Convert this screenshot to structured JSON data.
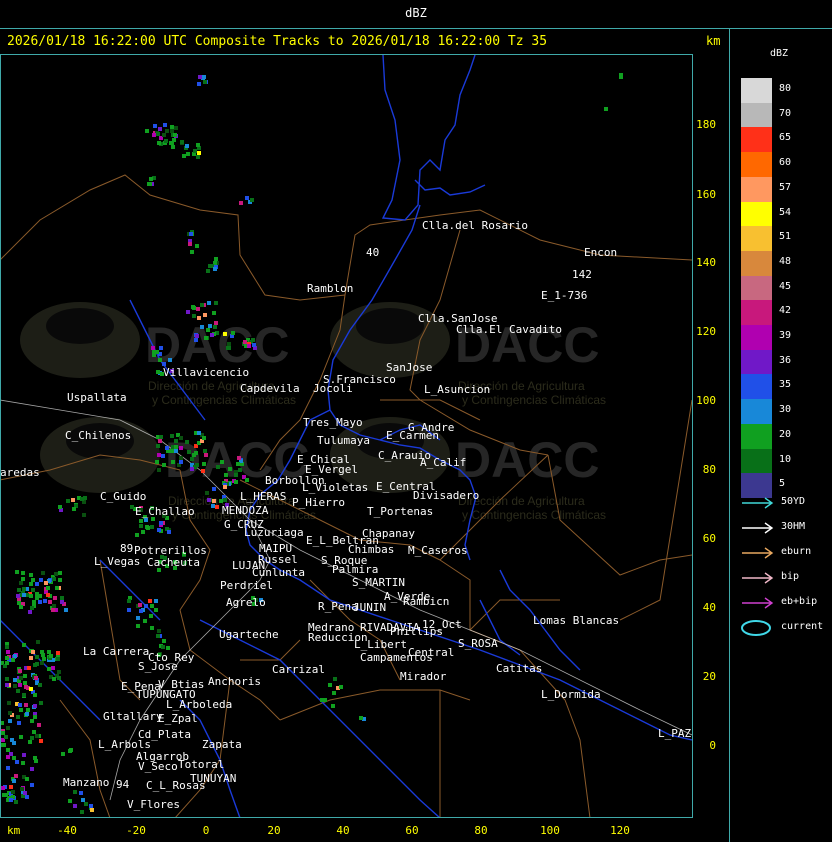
{
  "window": {
    "title": "dBZ"
  },
  "header": {
    "text": "2026/01/18 16:22:00 UTC Composite Tracks to 2026/01/18 16:22:00 Tz 35"
  },
  "axes": {
    "unit_top": "km",
    "unit_bottom": "km",
    "y_ticks": [
      "180",
      "160",
      "140",
      "120",
      "100",
      "80",
      "60",
      "40",
      "20",
      "0"
    ],
    "x_ticks": [
      "-40",
      "-20",
      "0",
      "20",
      "40",
      "60",
      "80",
      "100",
      "120"
    ]
  },
  "legend": {
    "title": "dBZ",
    "levels": [
      {
        "label": "80",
        "color": "#d8d8d8"
      },
      {
        "label": "70",
        "color": "#b8b8b8"
      },
      {
        "label": "65",
        "color": "#ff3018"
      },
      {
        "label": "60",
        "color": "#ff6800"
      },
      {
        "label": "57",
        "color": "#ff9860"
      },
      {
        "label": "54",
        "color": "#ffff00"
      },
      {
        "label": "51",
        "color": "#f8c030"
      },
      {
        "label": "48",
        "color": "#d8883c"
      },
      {
        "label": "45",
        "color": "#c86880"
      },
      {
        "label": "42",
        "color": "#c8187c"
      },
      {
        "label": "39",
        "color": "#b000b0"
      },
      {
        "label": "36",
        "color": "#7018c8"
      },
      {
        "label": "35",
        "color": "#2050e8"
      },
      {
        "label": "30",
        "color": "#1888d8"
      },
      {
        "label": "20",
        "color": "#10a020"
      },
      {
        "label": "10",
        "color": "#087018"
      },
      {
        "label": "5",
        "color": "#0a5010"
      }
    ],
    "last_swatch_color": "#3c3890",
    "tracks": [
      {
        "label": "50YD",
        "color": "#40d8d8",
        "type": "arrow"
      },
      {
        "label": "30HM",
        "color": "#ffffff",
        "type": "arrow"
      },
      {
        "label": "eburn",
        "color": "#e8a860",
        "type": "arrow"
      },
      {
        "label": "bip",
        "color": "#f0b8c8",
        "type": "arrow"
      },
      {
        "label": "eb+bip",
        "color": "#d040d0",
        "type": "arrow"
      },
      {
        "label": "current",
        "color": "#40d8e8",
        "type": "ellipse"
      }
    ]
  },
  "watermark": {
    "brand": "DACC",
    "line1": "Dirección de Agricultura",
    "line2": "y Contingencias Climáticas"
  },
  "places": [
    {
      "name": "Clla.del Rosario"
    },
    {
      "name": "Encon"
    },
    {
      "name": "142"
    },
    {
      "name": "E_1-736"
    },
    {
      "name": "Ramblon"
    },
    {
      "name": "40"
    },
    {
      "name": "Clla.SanJose"
    },
    {
      "name": "Clla.El Cavadito"
    },
    {
      "name": "Villavicencio"
    },
    {
      "name": "Capdevila"
    },
    {
      "name": "Jocoli"
    },
    {
      "name": "S.Francisco"
    },
    {
      "name": "SanJose"
    },
    {
      "name": "L_Asuncion"
    },
    {
      "name": "Uspallata"
    },
    {
      "name": "Tres_Mayo"
    },
    {
      "name": "G_Andre"
    },
    {
      "name": "Tulumaya"
    },
    {
      "name": "E_Carmen"
    },
    {
      "name": "C_Chilenos"
    },
    {
      "name": "E_Chical"
    },
    {
      "name": "C_Arauio"
    },
    {
      "name": "A_Calif"
    },
    {
      "name": "E_Vergel"
    },
    {
      "name": "aredas"
    },
    {
      "name": "Borbollon"
    },
    {
      "name": "L_Violetas"
    },
    {
      "name": "E_Central"
    },
    {
      "name": "Divisadero"
    },
    {
      "name": "C_Guido"
    },
    {
      "name": "L_HERAS"
    },
    {
      "name": "P_Hierro"
    },
    {
      "name": "E_Challao"
    },
    {
      "name": "MENDOZA"
    },
    {
      "name": "T_Portenas"
    },
    {
      "name": "G_CRUZ"
    },
    {
      "name": "Luzuriaga"
    },
    {
      "name": "Chapanay"
    },
    {
      "name": "E_L_Beltran"
    },
    {
      "name": "MAIPU"
    },
    {
      "name": "Chimbas"
    },
    {
      "name": "M_Caseros"
    },
    {
      "name": "Potrerillos"
    },
    {
      "name": "Russel"
    },
    {
      "name": "L_Vegas"
    },
    {
      "name": "Cacheuta"
    },
    {
      "name": "S_Roque"
    },
    {
      "name": "LUJAN"
    },
    {
      "name": "Palmira"
    },
    {
      "name": "Cunlunta"
    },
    {
      "name": "Perdriel"
    },
    {
      "name": "S_MARTIN"
    },
    {
      "name": "A_Verde"
    },
    {
      "name": "Rambicn"
    },
    {
      "name": "Agrelo"
    },
    {
      "name": "R_Pena"
    },
    {
      "name": "JUNIN"
    },
    {
      "name": "Lomas Blancas"
    },
    {
      "name": "Medrano"
    },
    {
      "name": "RIVADAVIA"
    },
    {
      "name": "12_Oct"
    },
    {
      "name": "Ugarteche"
    },
    {
      "name": "Reduccion"
    },
    {
      "name": "Phillips"
    },
    {
      "name": "S_ROSA"
    },
    {
      "name": "L_Libert"
    },
    {
      "name": "La Carrera"
    },
    {
      "name": "Cto_Rey"
    },
    {
      "name": "Campamentos"
    },
    {
      "name": "Central"
    },
    {
      "name": "S_Jose"
    },
    {
      "name": "Carrizal"
    },
    {
      "name": "Catitas"
    },
    {
      "name": "V_Btias"
    },
    {
      "name": "Anchoris"
    },
    {
      "name": "E_Pena"
    },
    {
      "name": "TUPUNGATO"
    },
    {
      "name": "Mirador"
    },
    {
      "name": "L_Dormida"
    },
    {
      "name": "L_Arboleda"
    },
    {
      "name": "Gltallary"
    },
    {
      "name": "E_Zpal"
    },
    {
      "name": "Cd_Plata"
    },
    {
      "name": "L_Arbols"
    },
    {
      "name": "Zapata"
    },
    {
      "name": "Algarrob"
    },
    {
      "name": "V_Seco"
    },
    {
      "name": "Totoral"
    },
    {
      "name": "L_PAZ"
    },
    {
      "name": "TUNUYAN"
    },
    {
      "name": "Manzano"
    },
    {
      "name": "C_L_Rosas"
    },
    {
      "name": "94"
    },
    {
      "name": "V_Flores"
    },
    {
      "name": "89"
    }
  ]
}
